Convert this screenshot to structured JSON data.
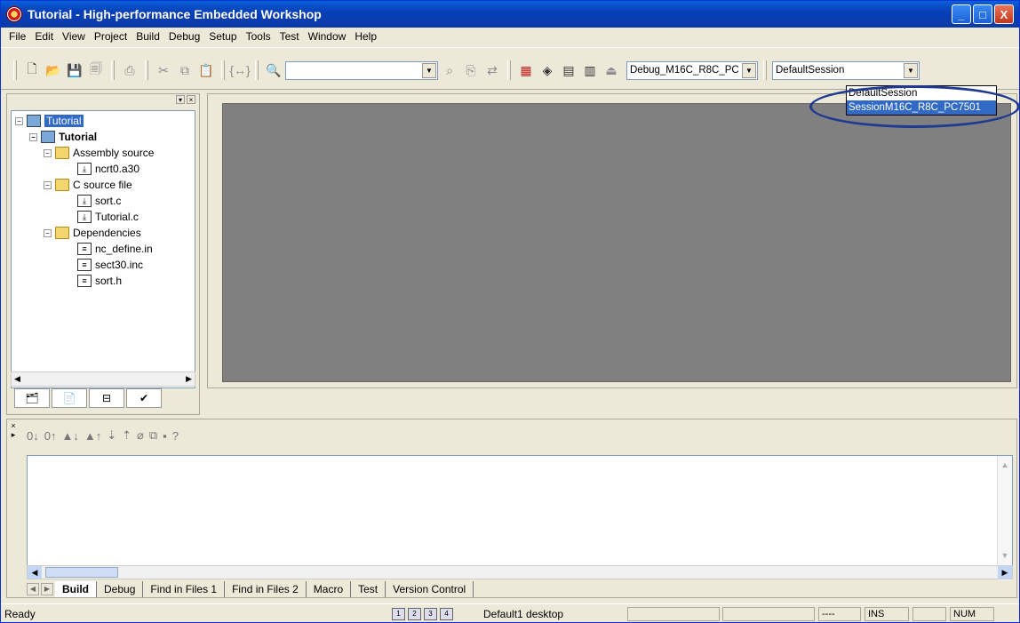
{
  "title": "Tutorial - High-performance Embedded Workshop",
  "window_controls": {
    "minimize": "_",
    "maximize": "□",
    "close": "X"
  },
  "menu": [
    "File",
    "Edit",
    "View",
    "Project",
    "Build",
    "Debug",
    "Setup",
    "Tools",
    "Test",
    "Window",
    "Help"
  ],
  "toolbar": {
    "find_value": "",
    "config_value": "Debug_M16C_R8C_PC",
    "session_value": "DefaultSession",
    "session_options": [
      "DefaultSession",
      "SessionM16C_R8C_PC7501"
    ]
  },
  "tree": {
    "root": "Tutorial",
    "project": "Tutorial",
    "groups": [
      {
        "name": "Assembly source",
        "files": [
          "ncrt0.a30"
        ]
      },
      {
        "name": "C source file",
        "files": [
          "sort.c",
          "Tutorial.c"
        ]
      },
      {
        "name": "Dependencies",
        "files": [
          "nc_define.in",
          "sect30.inc",
          "sort.h"
        ]
      }
    ]
  },
  "output_tabs": [
    "Build",
    "Debug",
    "Find in Files 1",
    "Find in Files 2",
    "Macro",
    "Test",
    "Version Control"
  ],
  "status": {
    "ready": "Ready",
    "desktop": "Default1 desktop",
    "dashes": "----",
    "ins": "INS",
    "num": "NUM"
  }
}
